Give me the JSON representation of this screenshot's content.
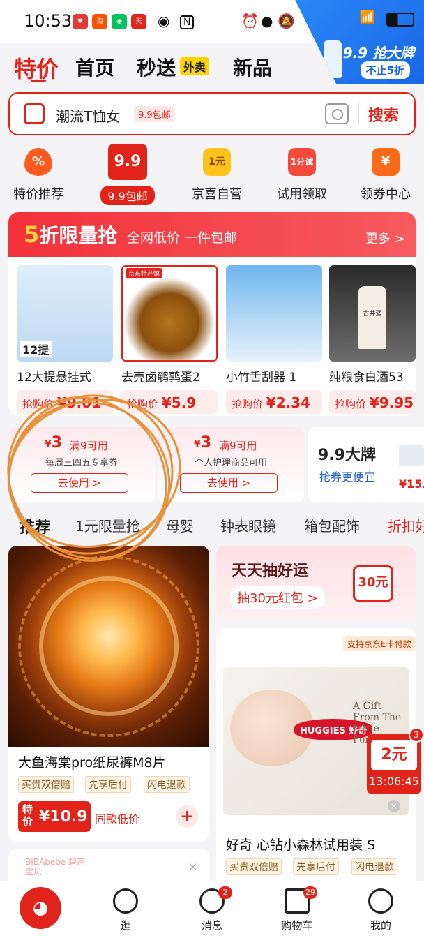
{
  "status_bar": {
    "time": "10:53",
    "app_badges": [
      "淘",
      "天"
    ],
    "nfc_label": "N"
  },
  "promo_corner": {
    "title": "9.9 抢大牌",
    "subtitle": "不止5折"
  },
  "nav": {
    "tabs": [
      "特价",
      "首页",
      "秒送",
      "新品"
    ],
    "active": "特价",
    "waimai_badge": "外卖"
  },
  "search": {
    "placeholder": "潮流T恤女",
    "tag": "9.9包邮",
    "button": "搜索"
  },
  "categories": [
    {
      "label": "特价推荐",
      "icon": "%"
    },
    {
      "label": "9.9包邮",
      "icon": "9.9"
    },
    {
      "label": "京喜自营",
      "icon": "1元"
    },
    {
      "label": "试用领取",
      "icon": "1分试"
    },
    {
      "label": "领券中心",
      "icon": "¥"
    }
  ],
  "flash_sale": {
    "number": "5",
    "title": "折限量抢",
    "subtitle": "全网低价 一件包邮",
    "more": "更多 >",
    "products": [
      {
        "name": "12大提悬挂式",
        "price_label": "抢购价",
        "price": "¥9.01",
        "img_text": "12提"
      },
      {
        "name": "去壳卤鹌鹑蛋2",
        "price_label": "抢购价",
        "price": "¥5.9",
        "img_text": "京东特产馆"
      },
      {
        "name": "小竹舌刮器 1",
        "price_label": "抢购价",
        "price": "¥2.34",
        "img_text": ""
      },
      {
        "name": "纯粮食白酒53",
        "price_label": "抢购价",
        "price": "¥9.95",
        "img_text": "古井酒"
      }
    ]
  },
  "coupons": [
    {
      "amount": "3",
      "condition": "满9可用",
      "desc": "每周三四五专享券",
      "button": "去使用 >"
    },
    {
      "amount": "3",
      "condition": "满9可用",
      "desc": "个人护理商品可用",
      "button": "去使用 >"
    }
  ],
  "brand99": {
    "title": "9.9大牌",
    "subtitle": "抢券更便宜",
    "price": "¥15."
  },
  "category_strip": [
    "推荐",
    "1元限量抢",
    "母婴",
    "钟表眼镜",
    "箱包配饰",
    "折扣好"
  ],
  "feed": {
    "item1": {
      "name": "大鱼海棠pro纸尿裤M8片",
      "tags": [
        "买贵双倍赔",
        "先享后付",
        "闪电退款"
      ],
      "price_tag": "特价",
      "price": "¥10.9",
      "same_label": "同款低价"
    },
    "item2": {
      "brand": "BIBAbebe 碧芭宝贝"
    },
    "lucky": {
      "title": "天天抽好运",
      "button": "抽30元红包 >",
      "card": "30元"
    },
    "item3": {
      "badge": "支持京东E卡付款",
      "brand_logo": "HUGGIES 好奇",
      "gift_text": "A Gift From The Little Forest",
      "name": "好奇 心钻小森林试用装 S",
      "tags": [
        "买贵双倍赔",
        "先享后付",
        "闪电退款"
      ]
    }
  },
  "float_coupon": {
    "amount": "2元",
    "countdown": "13:06:45",
    "count": "3"
  },
  "bottom_nav": {
    "items": [
      {
        "label": "逛",
        "badge": ""
      },
      {
        "label": "消息",
        "badge": "2"
      },
      {
        "label": "购物车",
        "badge": "29"
      },
      {
        "label": "我的",
        "badge": ""
      }
    ]
  }
}
